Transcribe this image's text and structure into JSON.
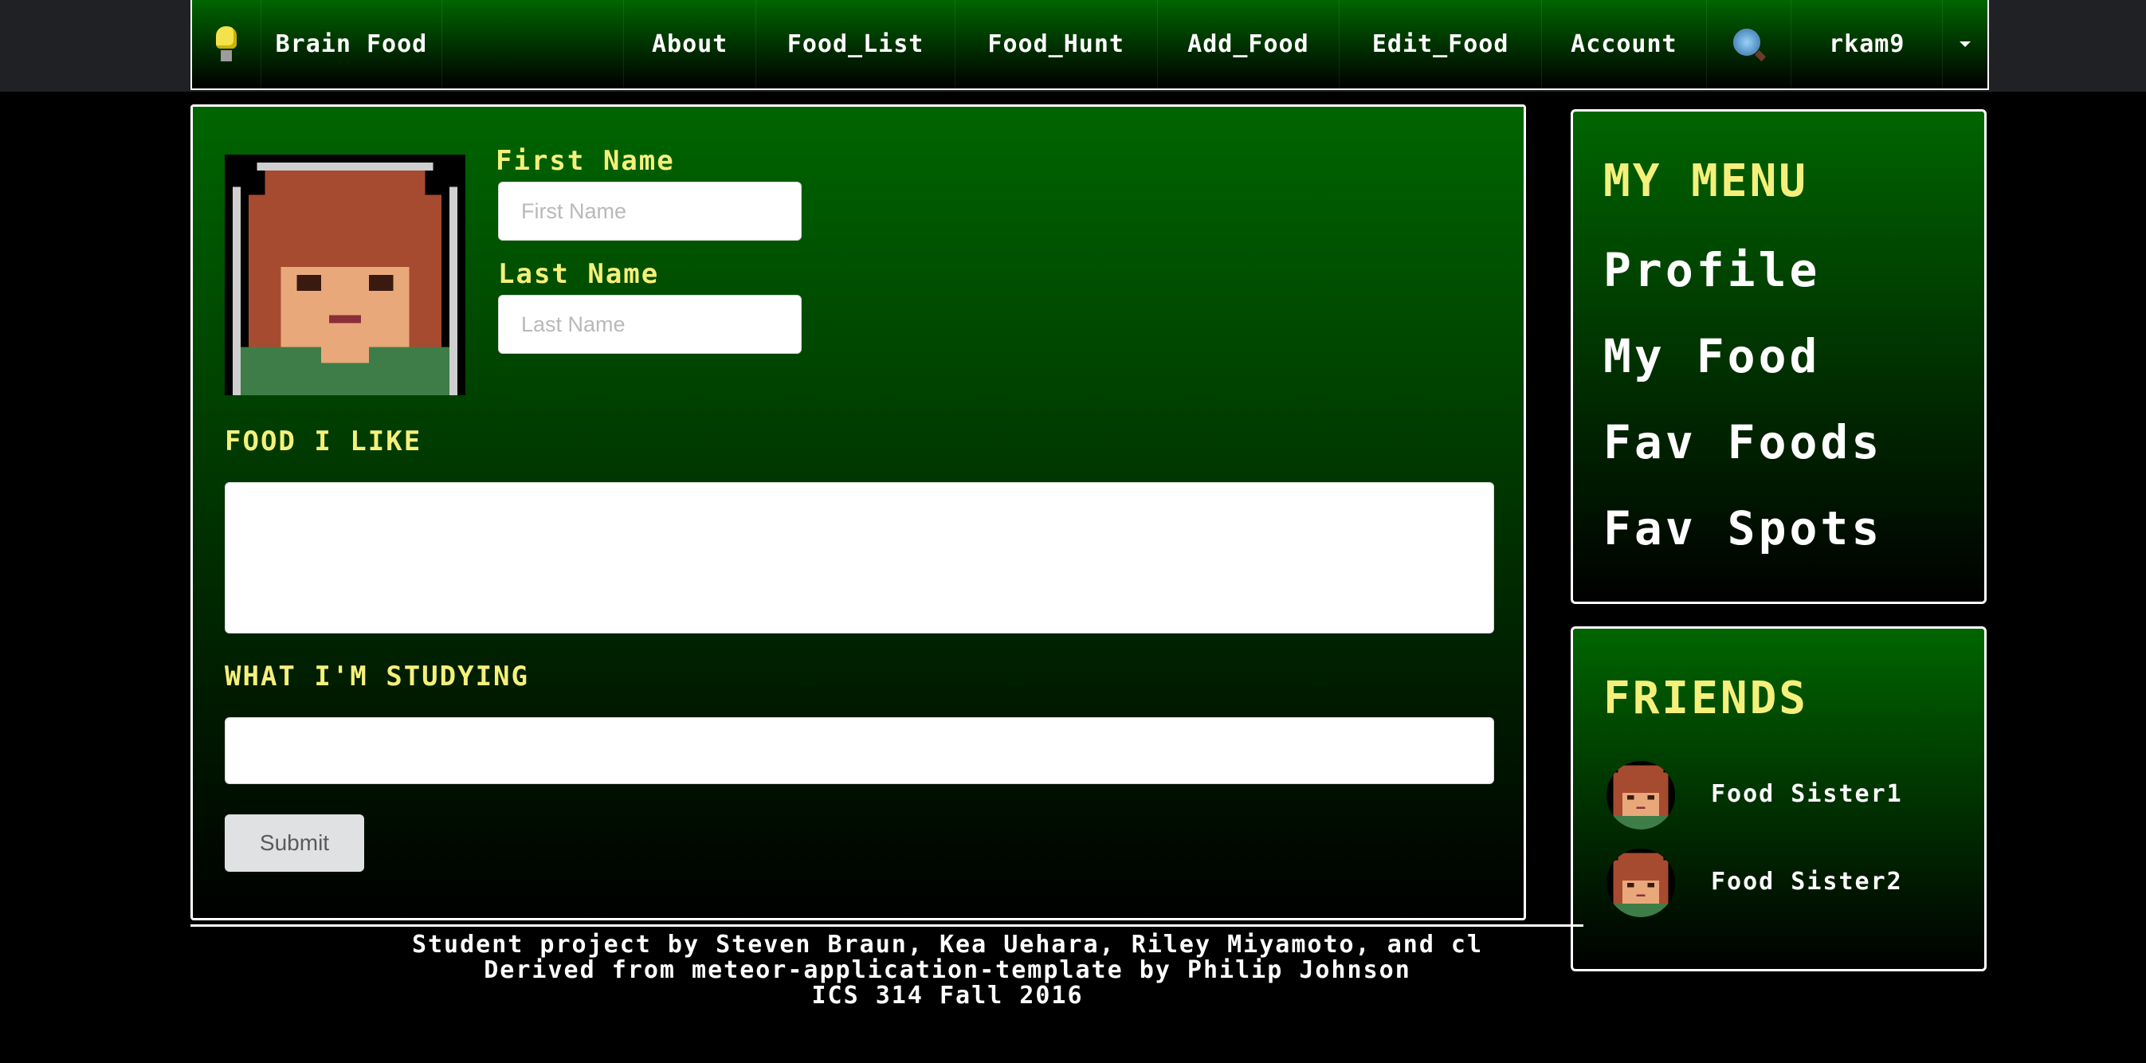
{
  "brand": {
    "name": "Brain Food",
    "logo_icon": "lightbulb-icon"
  },
  "nav": {
    "items": [
      {
        "label": "About"
      },
      {
        "label": "Food_List"
      },
      {
        "label": "Food_Hunt"
      },
      {
        "label": "Add_Food"
      },
      {
        "label": "Edit_Food"
      },
      {
        "label": "Account"
      }
    ],
    "search_icon": "magnifier-icon",
    "user": "rkam9",
    "caret_icon": "caret-down-icon"
  },
  "profile_form": {
    "first_name_label": "First Name",
    "first_name_placeholder": "First Name",
    "first_name_value": "",
    "last_name_label": "Last Name",
    "last_name_placeholder": "Last Name",
    "last_name_value": "",
    "food_label": "FOOD I LIKE",
    "food_value": "",
    "studying_label": "WHAT I'M STUDYING",
    "studying_value": "",
    "submit_label": "Submit"
  },
  "menu": {
    "title": "MY MENU",
    "items": [
      {
        "label": "Profile"
      },
      {
        "label": "My Food"
      },
      {
        "label": "Fav Foods"
      },
      {
        "label": "Fav Spots"
      }
    ]
  },
  "friends": {
    "title": "FRIENDS",
    "items": [
      {
        "name": "Food Sister1"
      },
      {
        "name": "Food Sister2"
      }
    ]
  },
  "footer": {
    "line1": "Student project by Steven Braun, Kea Uehara, Riley Miyamoto, and cl",
    "line2": "Derived from meteor-application-template by Philip Johnson",
    "line3": "ICS 314 Fall 2016"
  },
  "colors": {
    "panel_green": "#006500",
    "label_yellow": "#f5f07b",
    "border_white": "#ffffff"
  }
}
